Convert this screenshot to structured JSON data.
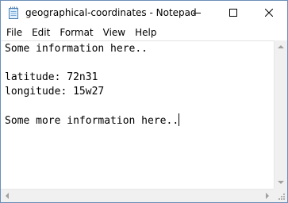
{
  "window": {
    "title": "geographical-coordinates - Notepad",
    "icon": "notepad-icon"
  },
  "titlebar_buttons": {
    "minimize_icon": "minimize-icon",
    "maximize_icon": "maximize-icon",
    "close_icon": "close-icon"
  },
  "menu": {
    "items": [
      "File",
      "Edit",
      "Format",
      "View",
      "Help"
    ]
  },
  "editor": {
    "lines": [
      "Some information here..",
      "",
      "latitude: 72n31",
      "longitude: 15w27",
      "",
      "Some more information here.."
    ]
  },
  "colors": {
    "window_border": "#6b8fb8",
    "scrollbar_track": "#f0f0f0",
    "arrow": "#a0a0a0"
  }
}
